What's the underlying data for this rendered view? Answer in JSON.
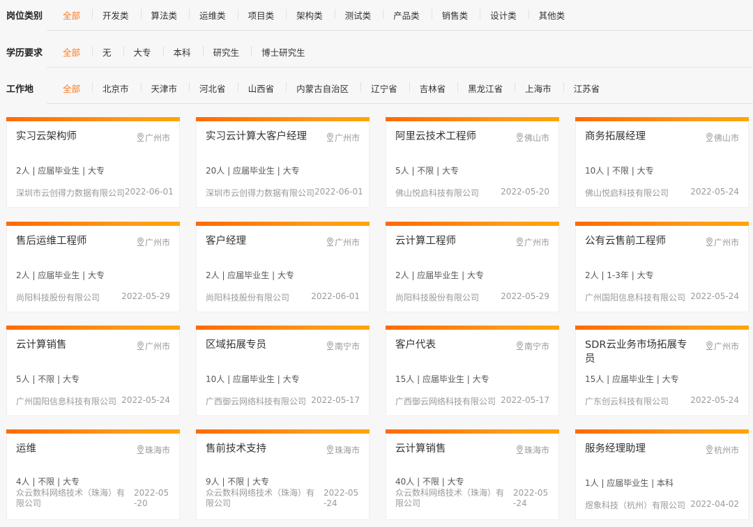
{
  "filters": [
    {
      "label": "岗位类别",
      "options": [
        "全部",
        "开发类",
        "算法类",
        "运维类",
        "项目类",
        "架构类",
        "测试类",
        "产品类",
        "销售类",
        "设计类",
        "其他类"
      ],
      "active": 0
    },
    {
      "label": "学历要求",
      "options": [
        "全部",
        "无",
        "大专",
        "本科",
        "研究生",
        "博士研究生"
      ],
      "active": 0
    },
    {
      "label": "工作地",
      "options": [
        "全部",
        "北京市",
        "天津市",
        "河北省",
        "山西省",
        "内蒙古自治区",
        "辽宁省",
        "吉林省",
        "黑龙江省",
        "上海市",
        "江苏省"
      ],
      "active": 0
    }
  ],
  "colors": {
    "accent": "#ff7a1a",
    "bar_start": "#ff6a00",
    "bar_end": "#ffa500"
  },
  "jobs": [
    {
      "title": "实习云架构师",
      "location": "广州市",
      "meta": "2人 | 应届毕业生 | 大专",
      "company": "深圳市云创得力数据有限公司",
      "date": "2022-06-01"
    },
    {
      "title": "实习云计算大客户经理",
      "location": "广州市",
      "meta": "20人 | 应届毕业生 | 大专",
      "company": "深圳市云创得力数据有限公司",
      "date": "2022-06-01"
    },
    {
      "title": "阿里云技术工程师",
      "location": "佛山市",
      "meta": "5人 | 不限 | 大专",
      "company": "佛山悦启科技有限公司",
      "date": "2022-05-20"
    },
    {
      "title": "商务拓展经理",
      "location": "佛山市",
      "meta": "10人 | 不限 | 大专",
      "company": "佛山悦启科技有限公司",
      "date": "2022-05-24"
    },
    {
      "title": "售后运维工程师",
      "location": "广州市",
      "meta": "2人 | 应届毕业生 | 大专",
      "company": "尚阳科技股份有限公司",
      "date": "2022-05-29"
    },
    {
      "title": "客户经理",
      "location": "广州市",
      "meta": "2人 | 应届毕业生 | 大专",
      "company": "尚阳科技股份有限公司",
      "date": "2022-06-01"
    },
    {
      "title": "云计算工程师",
      "location": "广州市",
      "meta": "2人 | 应届毕业生 | 大专",
      "company": "尚阳科技股份有限公司",
      "date": "2022-05-29"
    },
    {
      "title": "公有云售前工程师",
      "location": "广州市",
      "meta": "2人 | 1-3年 | 大专",
      "company": "广州国阳信息科技有限公司",
      "date": "2022-05-24"
    },
    {
      "title": "云计算销售",
      "location": "广州市",
      "meta": "5人 | 不限 | 大专",
      "company": "广州国阳信息科技有限公司",
      "date": "2022-05-24"
    },
    {
      "title": "区域拓展专员",
      "location": "南宁市",
      "meta": "10人 | 应届毕业生 | 大专",
      "company": "广西御云网络科技有限公司",
      "date": "2022-05-17"
    },
    {
      "title": "客户代表",
      "location": "南宁市",
      "meta": "15人 | 应届毕业生 | 大专",
      "company": "广西御云网络科技有限公司",
      "date": "2022-05-17"
    },
    {
      "title": "SDR云业务市场拓展专员",
      "location": "广州市",
      "meta": "15人 | 应届毕业生 | 大专",
      "company": "广东创云科技有限公司",
      "date": "2022-05-24"
    },
    {
      "title": "运维",
      "location": "珠海市",
      "meta": "4人 | 不限 | 大专",
      "company": "众云数科网络技术（珠海）有限公司",
      "date": "2022-05-20"
    },
    {
      "title": "售前技术支持",
      "location": "珠海市",
      "meta": "9人 | 不限 | 大专",
      "company": "众云数科网络技术（珠海）有限公司",
      "date": "2022-05-24"
    },
    {
      "title": "云计算销售",
      "location": "珠海市",
      "meta": "40人 | 不限 | 大专",
      "company": "众云数科网络技术（珠海）有限公司",
      "date": "2022-05-24"
    },
    {
      "title": "服务经理助理",
      "location": "杭州市",
      "meta": "1人 | 应届毕业生 | 本科",
      "company": "煜象科技（杭州）有限公司",
      "date": "2022-04-02"
    }
  ]
}
